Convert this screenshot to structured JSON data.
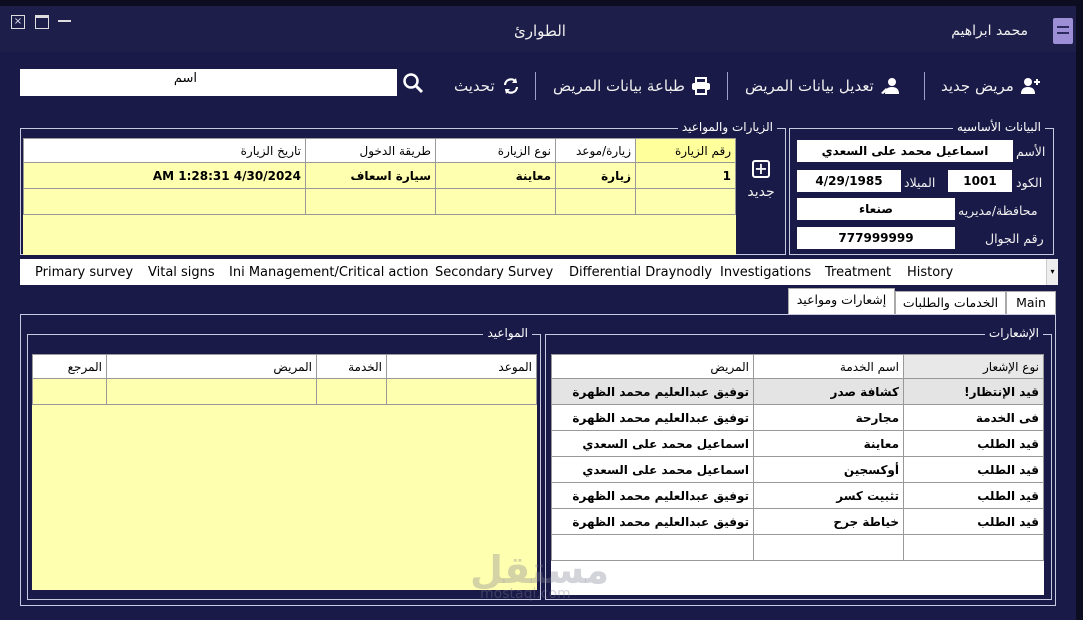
{
  "window": {
    "title": "الطوارئ",
    "user": "محمد ابراهيم"
  },
  "toolbar": {
    "search_value": "اسم",
    "refresh": "تحديث",
    "print": "طباعة بيانات المريض",
    "edit": "تعديل بيانات المريض",
    "new_patient": "مريض جديد"
  },
  "basic": {
    "title": "البيانات الأساسيه",
    "name_label": "الأسم",
    "name": "اسماعيل محمد على السعدي",
    "code_label": "الكود",
    "code": "1001",
    "birth_label": "الميلاد",
    "birth": "4/29/1985",
    "gov_label": "محافظة/مديريه",
    "gov": "صنعاء",
    "mobile_label": "رقم الجوال",
    "mobile": "777999999"
  },
  "visits": {
    "title": "الزيارات والمواعيد",
    "new_label": "جديد",
    "headers": [
      "رقم الزيارة",
      "زيارة/موعد",
      "نوع الزيارة",
      "طريقة الدخول",
      "تاريخ الزيارة"
    ],
    "row": [
      "1",
      "زيارة",
      "معاينة",
      "سيارة اسعاف",
      "4/30/2024 1:28:31 AM"
    ]
  },
  "tabs": [
    "Primary survey",
    "Vital signs",
    "Ini Management/Critical action",
    "Secondary Survey",
    "Differential Draynodly",
    "Investigations",
    "Treatment",
    "History"
  ],
  "subtabs": {
    "main": "Main",
    "services": "الخدمات والطلبات",
    "notifications": "إشعارات ومواعيد"
  },
  "notifications": {
    "title": "الإشعارات",
    "headers": [
      "نوع الإشعار",
      "اسم الخدمة",
      "المريض"
    ],
    "rows": [
      [
        "قيد الإنتظار!",
        "كشافة صدر",
        "توفيق عبدالعليم محمد الظهرة"
      ],
      [
        "فى الخدمة",
        "مجارحة",
        "توفيق عبدالعليم محمد الظهرة"
      ],
      [
        "قيد الطلب",
        "معاينة",
        "اسماعيل محمد على السعدي"
      ],
      [
        "قيد الطلب",
        "أوكسجين",
        "اسماعيل محمد على السعدي"
      ],
      [
        "قيد الطلب",
        "تثبيت كسر",
        "توفيق عبدالعليم محمد الظهرة"
      ],
      [
        "قيد الطلب",
        "خياطة جرح",
        "توفيق عبدالعليم محمد الظهرة"
      ]
    ]
  },
  "appointments": {
    "title": "المواعيد",
    "headers": [
      "الموعد",
      "الخدمة",
      "المريض",
      "المرجع"
    ]
  },
  "watermark": {
    "ar": "مستقل",
    "en": "mostaql.com"
  },
  "colors": {
    "bg": "#1a1a48",
    "grid": "#ffffb0"
  }
}
